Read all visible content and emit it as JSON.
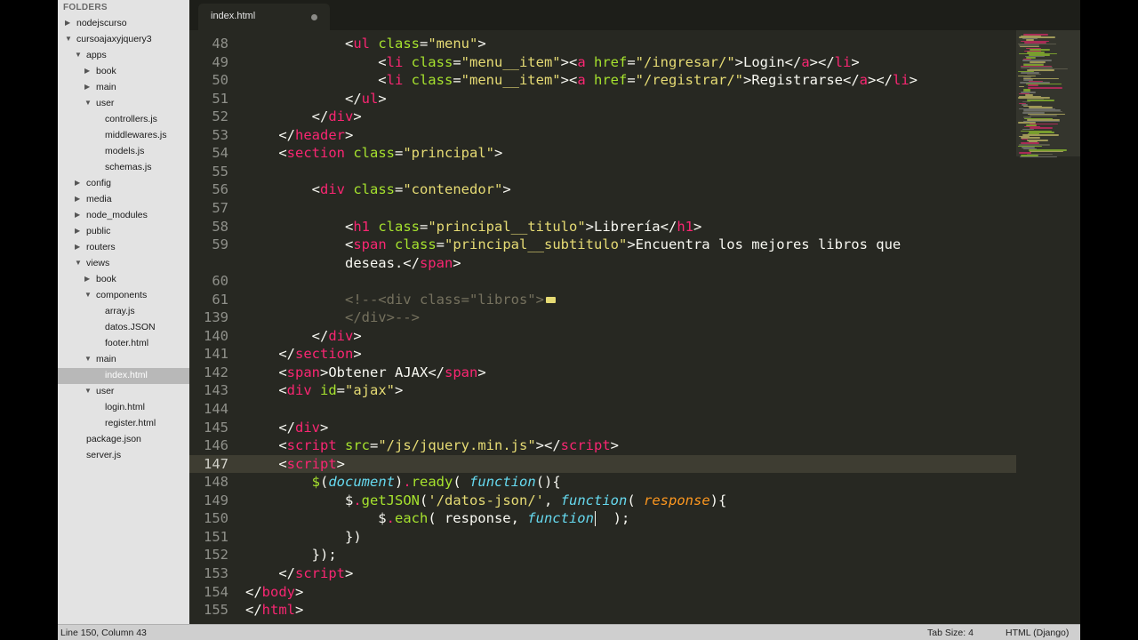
{
  "sidebar": {
    "title": "FOLDERS",
    "tree": [
      {
        "label": "nodejscurso",
        "level": 0,
        "arrow": "right"
      },
      {
        "label": "cursoajaxyjquery3",
        "level": 0,
        "arrow": "down"
      },
      {
        "label": "apps",
        "level": 1,
        "arrow": "down"
      },
      {
        "label": "book",
        "level": 2,
        "arrow": "right"
      },
      {
        "label": "main",
        "level": 2,
        "arrow": "right"
      },
      {
        "label": "user",
        "level": 2,
        "arrow": "down"
      },
      {
        "label": "controllers.js",
        "level": 3,
        "arrow": "none"
      },
      {
        "label": "middlewares.js",
        "level": 3,
        "arrow": "none"
      },
      {
        "label": "models.js",
        "level": 3,
        "arrow": "none"
      },
      {
        "label": "schemas.js",
        "level": 3,
        "arrow": "none"
      },
      {
        "label": "config",
        "level": 1,
        "arrow": "right"
      },
      {
        "label": "media",
        "level": 1,
        "arrow": "right"
      },
      {
        "label": "node_modules",
        "level": 1,
        "arrow": "right"
      },
      {
        "label": "public",
        "level": 1,
        "arrow": "right"
      },
      {
        "label": "routers",
        "level": 1,
        "arrow": "right"
      },
      {
        "label": "views",
        "level": 1,
        "arrow": "down"
      },
      {
        "label": "book",
        "level": 2,
        "arrow": "right"
      },
      {
        "label": "components",
        "level": 2,
        "arrow": "down"
      },
      {
        "label": "array.js",
        "level": 3,
        "arrow": "none"
      },
      {
        "label": "datos.JSON",
        "level": 3,
        "arrow": "none"
      },
      {
        "label": "footer.html",
        "level": 3,
        "arrow": "none"
      },
      {
        "label": "main",
        "level": 2,
        "arrow": "down"
      },
      {
        "label": "index.html",
        "level": 3,
        "arrow": "none",
        "selected": true
      },
      {
        "label": "user",
        "level": 2,
        "arrow": "down"
      },
      {
        "label": "login.html",
        "level": 3,
        "arrow": "none"
      },
      {
        "label": "register.html",
        "level": 3,
        "arrow": "none"
      },
      {
        "label": "package.json",
        "level": 1,
        "arrow": "none"
      },
      {
        "label": "server.js",
        "level": 1,
        "arrow": "none"
      }
    ]
  },
  "tab": {
    "label": "index.html",
    "modified_icon": "circle-dot-icon"
  },
  "editor": {
    "active_line_index": 23,
    "lines": [
      {
        "n": "48",
        "tokens": [
          [
            "",
            "            <"
          ],
          [
            "t",
            "ul"
          ],
          [
            "a",
            " class"
          ],
          [
            "",
            "="
          ],
          [
            "s",
            "\"menu\""
          ],
          [
            "",
            ">"
          ]
        ]
      },
      {
        "n": "49",
        "tokens": [
          [
            "",
            "                <"
          ],
          [
            "t",
            "li"
          ],
          [
            "a",
            " class"
          ],
          [
            "",
            "="
          ],
          [
            "s",
            "\"menu__item\""
          ],
          [
            "",
            "><"
          ],
          [
            "t",
            "a"
          ],
          [
            "a",
            " href"
          ],
          [
            "",
            "="
          ],
          [
            "s",
            "\"/ingresar/\""
          ],
          [
            "",
            ">Login</"
          ],
          [
            "t",
            "a"
          ],
          [
            "",
            "></"
          ],
          [
            "t",
            "li"
          ],
          [
            "",
            ">"
          ]
        ]
      },
      {
        "n": "50",
        "tokens": [
          [
            "",
            "                <"
          ],
          [
            "t",
            "li"
          ],
          [
            "a",
            " class"
          ],
          [
            "",
            "="
          ],
          [
            "s",
            "\"menu__item\""
          ],
          [
            "",
            "><"
          ],
          [
            "t",
            "a"
          ],
          [
            "a",
            " href"
          ],
          [
            "",
            "="
          ],
          [
            "s",
            "\"/registrar/\""
          ],
          [
            "",
            ">Registrarse</"
          ],
          [
            "t",
            "a"
          ],
          [
            "",
            "></"
          ],
          [
            "t",
            "li"
          ],
          [
            "",
            ">"
          ]
        ]
      },
      {
        "n": "51",
        "tokens": [
          [
            "",
            "            </"
          ],
          [
            "t",
            "ul"
          ],
          [
            "",
            ">"
          ]
        ]
      },
      {
        "n": "52",
        "tokens": [
          [
            "",
            "        </"
          ],
          [
            "t",
            "div"
          ],
          [
            "",
            ">"
          ]
        ]
      },
      {
        "n": "53",
        "tokens": [
          [
            "",
            "    </"
          ],
          [
            "t",
            "header"
          ],
          [
            "",
            ">"
          ]
        ]
      },
      {
        "n": "54",
        "tokens": [
          [
            "",
            "    <"
          ],
          [
            "t",
            "section"
          ],
          [
            "a",
            " class"
          ],
          [
            "",
            "="
          ],
          [
            "s",
            "\"principal\""
          ],
          [
            "",
            ">"
          ]
        ]
      },
      {
        "n": "55",
        "tokens": [
          [
            "",
            ""
          ]
        ]
      },
      {
        "n": "56",
        "tokens": [
          [
            "",
            "        <"
          ],
          [
            "t",
            "div"
          ],
          [
            "a",
            " class"
          ],
          [
            "",
            "="
          ],
          [
            "s",
            "\"contenedor\""
          ],
          [
            "",
            ">"
          ]
        ]
      },
      {
        "n": "57",
        "tokens": [
          [
            "",
            ""
          ]
        ]
      },
      {
        "n": "58",
        "tokens": [
          [
            "",
            "            <"
          ],
          [
            "t",
            "h1"
          ],
          [
            "a",
            " class"
          ],
          [
            "",
            "="
          ],
          [
            "s",
            "\"principal__titulo\""
          ],
          [
            "",
            ">Librería</"
          ],
          [
            "t",
            "h1"
          ],
          [
            "",
            ">"
          ]
        ]
      },
      {
        "n": "59",
        "tokens": [
          [
            "",
            "            <"
          ],
          [
            "t",
            "span"
          ],
          [
            "a",
            " class"
          ],
          [
            "",
            "="
          ],
          [
            "s",
            "\"principal__subtitulo\""
          ],
          [
            "",
            ">Encuentra los mejores libros que"
          ]
        ]
      },
      {
        "n": "",
        "tokens": [
          [
            "",
            "            deseas.</"
          ],
          [
            "t",
            "span"
          ],
          [
            "",
            ">"
          ]
        ]
      },
      {
        "n": "60",
        "tokens": [
          [
            "",
            ""
          ]
        ]
      },
      {
        "n": "61",
        "tokens": [
          [
            "c",
            "            <!--<div class=\"libros\">"
          ],
          [
            "fold",
            ""
          ]
        ]
      },
      {
        "n": "139",
        "tokens": [
          [
            "c",
            "            </div>-->"
          ]
        ]
      },
      {
        "n": "140",
        "tokens": [
          [
            "",
            "        </"
          ],
          [
            "t",
            "div"
          ],
          [
            "",
            ">"
          ]
        ]
      },
      {
        "n": "141",
        "tokens": [
          [
            "",
            "    </"
          ],
          [
            "t",
            "section"
          ],
          [
            "",
            ">"
          ]
        ]
      },
      {
        "n": "142",
        "tokens": [
          [
            "",
            "    <"
          ],
          [
            "t",
            "span"
          ],
          [
            "",
            ">Obtener AJAX</"
          ],
          [
            "t",
            "span"
          ],
          [
            "",
            ">"
          ]
        ]
      },
      {
        "n": "143",
        "tokens": [
          [
            "",
            "    <"
          ],
          [
            "t",
            "div"
          ],
          [
            "a",
            " id"
          ],
          [
            "",
            "="
          ],
          [
            "s",
            "\"ajax\""
          ],
          [
            "",
            ">"
          ]
        ]
      },
      {
        "n": "144",
        "tokens": [
          [
            "",
            ""
          ]
        ]
      },
      {
        "n": "145",
        "tokens": [
          [
            "",
            "    </"
          ],
          [
            "t",
            "div"
          ],
          [
            "",
            ">"
          ]
        ]
      },
      {
        "n": "146",
        "tokens": [
          [
            "",
            "    <"
          ],
          [
            "t",
            "script"
          ],
          [
            "a",
            " src"
          ],
          [
            "",
            "="
          ],
          [
            "s",
            "\"/js/jquery.min.js\""
          ],
          [
            "",
            "></"
          ],
          [
            "t",
            "script"
          ],
          [
            "",
            ">"
          ]
        ]
      },
      {
        "n": "147",
        "tokens": [
          [
            "",
            "    <"
          ],
          [
            "t",
            "script"
          ],
          [
            "",
            ">"
          ]
        ]
      },
      {
        "n": "148",
        "tokens": [
          [
            "",
            "        "
          ],
          [
            "f",
            "$"
          ],
          [
            "",
            "("
          ],
          [
            "i",
            "document"
          ],
          [
            "",
            ")"
          ],
          [
            "t",
            "."
          ],
          [
            "f",
            "ready"
          ],
          [
            "",
            "( "
          ],
          [
            "i",
            "function"
          ],
          [
            "",
            "(){"
          ]
        ]
      },
      {
        "n": "149",
        "tokens": [
          [
            "",
            "            $"
          ],
          [
            "t",
            "."
          ],
          [
            "f",
            "getJSON"
          ],
          [
            "",
            "("
          ],
          [
            "s",
            "'/datos-json/'"
          ],
          [
            "",
            ", "
          ],
          [
            "i",
            "function"
          ],
          [
            "",
            "( "
          ],
          [
            "p",
            "response"
          ],
          [
            "",
            ""
          ],
          [
            "",
            ")"
          ],
          [
            "",
            "{"
          ]
        ]
      },
      {
        "n": "150",
        "tokens": [
          [
            "",
            "                $"
          ],
          [
            "t",
            "."
          ],
          [
            "f",
            "each"
          ],
          [
            "",
            "( response, "
          ],
          [
            "i",
            "function"
          ],
          [
            "caret",
            ""
          ],
          [
            "",
            "  );"
          ]
        ]
      },
      {
        "n": "151",
        "tokens": [
          [
            "",
            "            })"
          ]
        ]
      },
      {
        "n": "152",
        "tokens": [
          [
            "",
            "        });"
          ]
        ]
      },
      {
        "n": "153",
        "tokens": [
          [
            "",
            "    </"
          ],
          [
            "t",
            "script"
          ],
          [
            "",
            ">"
          ]
        ]
      },
      {
        "n": "154",
        "tokens": [
          [
            "",
            "</"
          ],
          [
            "t",
            "body"
          ],
          [
            "",
            ">"
          ]
        ]
      },
      {
        "n": "155",
        "tokens": [
          [
            "",
            "</"
          ],
          [
            "t",
            "html"
          ],
          [
            "",
            ">"
          ]
        ]
      }
    ]
  },
  "statusbar": {
    "position": "Line 150, Column 43",
    "tab_size": "Tab Size: 4",
    "syntax": "HTML (Django)"
  },
  "colors": {
    "editor_bg": "#272822",
    "tag": "#f92672",
    "attribute": "#a6e22e",
    "string": "#e6db74",
    "comment": "#75715e",
    "keyword": "#66d9ef",
    "parameter": "#fd971f"
  }
}
